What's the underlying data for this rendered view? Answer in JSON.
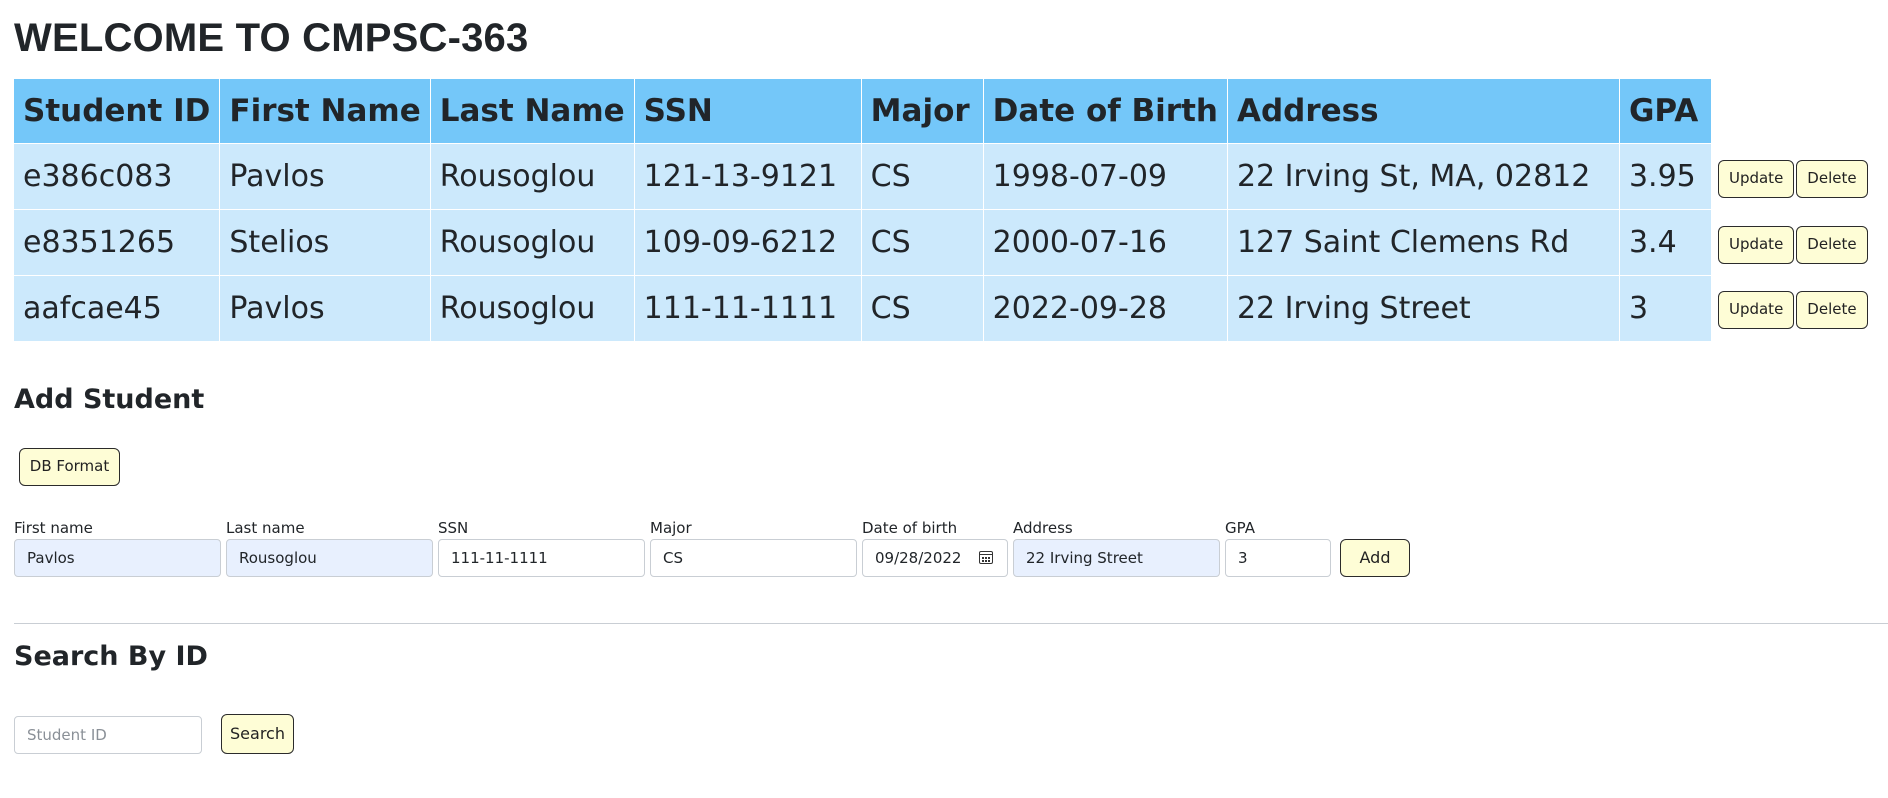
{
  "title": "WELCOME TO CMPSC-363",
  "table": {
    "headers": [
      "Student ID",
      "First Name",
      "Last Name",
      "SSN",
      "Major",
      "Date of Birth",
      "Address",
      "GPA"
    ],
    "rows": [
      [
        "e386c083",
        "Pavlos",
        "Rousoglou",
        "121-13-9121",
        "CS",
        "1998-07-09",
        "22 Irving St, MA, 02812",
        "3.95"
      ],
      [
        "e8351265",
        "Stelios",
        "Rousoglou",
        "109-09-6212",
        "CS",
        "2000-07-16",
        "127 Saint Clemens Rd",
        "3.4"
      ],
      [
        "aafcae45",
        "Pavlos",
        "Rousoglou",
        "111-11-1111",
        "CS",
        "2022-09-28",
        "22 Irving Street",
        "3"
      ]
    ],
    "update_label": "Update",
    "delete_label": "Delete"
  },
  "add_student": {
    "heading": "Add Student",
    "db_format_label": "DB Format",
    "fields": {
      "first_name": {
        "label": "First name",
        "value": "Pavlos"
      },
      "last_name": {
        "label": "Last name",
        "value": "Rousoglou"
      },
      "ssn": {
        "label": "SSN",
        "value": "111-11-1111"
      },
      "major": {
        "label": "Major",
        "value": "CS"
      },
      "dob": {
        "label": "Date of birth",
        "value": "09/28/2022"
      },
      "address": {
        "label": "Address",
        "value": "22 Irving Street"
      },
      "gpa": {
        "label": "GPA",
        "value": "3"
      }
    },
    "add_label": "Add"
  },
  "search": {
    "heading": "Search By ID",
    "placeholder": "Student ID",
    "button_label": "Search"
  },
  "colors": {
    "header_bg": "#74c7f9",
    "row_bg": "#cce9fc",
    "button_bg": "#fefdd6",
    "autofill_bg": "#e8f0fe"
  }
}
